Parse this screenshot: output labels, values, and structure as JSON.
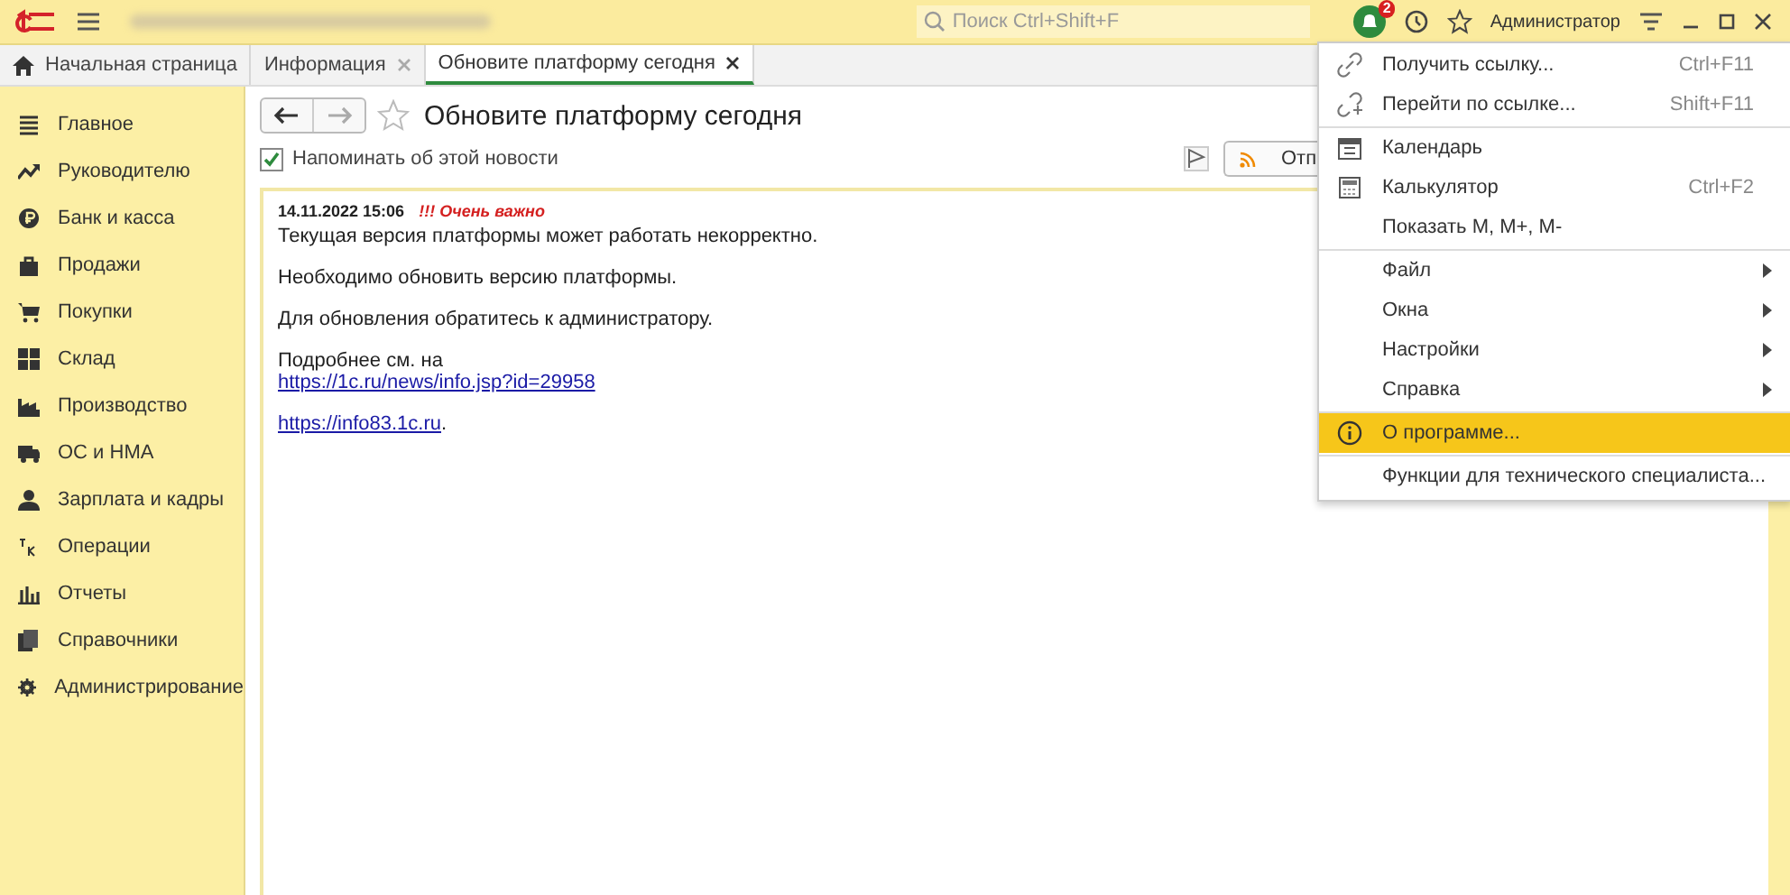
{
  "app_bar": {
    "search_placeholder": "Поиск Ctrl+Shift+F",
    "notifications": "2",
    "user": "Администратор"
  },
  "tabs": [
    {
      "label": "Начальная страница",
      "kind": "home",
      "selected": false
    },
    {
      "label": "Информация",
      "kind": "closable",
      "selected": false
    },
    {
      "label": "Обновите платформу сегодня",
      "kind": "closable",
      "selected": true
    }
  ],
  "sidebar": {
    "items": [
      {
        "label": "Главное",
        "kind": "list"
      },
      {
        "label": "Руководителю",
        "kind": "trend"
      },
      {
        "label": "Банк и касса",
        "kind": "coin"
      },
      {
        "label": "Продажи",
        "kind": "bag"
      },
      {
        "label": "Покупки",
        "kind": "cart"
      },
      {
        "label": "Склад",
        "kind": "grid"
      },
      {
        "label": "Производство",
        "kind": "factory"
      },
      {
        "label": "ОС и НМА",
        "kind": "truck"
      },
      {
        "label": "Зарплата и кадры",
        "kind": "person"
      },
      {
        "label": "Операции",
        "kind": "dtkt"
      },
      {
        "label": "Отчеты",
        "kind": "bars"
      },
      {
        "label": "Справочники",
        "kind": "books"
      },
      {
        "label": "Администрирование",
        "kind": "gear"
      }
    ]
  },
  "page": {
    "title": "Обновите платформу сегодня",
    "favorite": false,
    "remind": {
      "label": "Напоминать об этой новости",
      "checked": true
    },
    "button": "Отп",
    "news": {
      "date": "14.11.2022 15:06",
      "importance": "!!! Очень важно",
      "paragraphs": [
        {
          "lines": [
            {
              "kind": "text",
              "text": "Текущая версия платформы может работать некорректно."
            }
          ]
        },
        {
          "lines": [
            {
              "kind": "text",
              "text": "Необходимо обновить версию платформы."
            }
          ]
        },
        {
          "lines": [
            {
              "kind": "text",
              "text": "Для обновления обратитесь к администратору."
            }
          ]
        },
        {
          "lines": [
            {
              "kind": "text",
              "text": "Подробнее см. на"
            },
            {
              "kind": "link",
              "text": "https://1c.ru/news/info.jsp?id=29958"
            }
          ]
        },
        {
          "lines": [
            {
              "kind": "link",
              "text": "https://info83.1c.ru",
              "after": "."
            }
          ]
        }
      ]
    }
  },
  "menu": {
    "items": [
      {
        "label": "Получить ссылку...",
        "shortcut": "Ctrl+F11",
        "kind": "link",
        "separator_before": false,
        "submenu": false,
        "selected": false
      },
      {
        "label": "Перейти по ссылке...",
        "shortcut": "Shift+F11",
        "kind": "goto",
        "separator_before": false,
        "submenu": false,
        "selected": false
      },
      {
        "label": "Календарь",
        "kind": "calendar",
        "separator_before": true,
        "submenu": false,
        "selected": false
      },
      {
        "label": "Калькулятор",
        "shortcut": "Ctrl+F2",
        "kind": "calculator",
        "separator_before": false,
        "submenu": false,
        "selected": false
      },
      {
        "label": "Показать M, M+, M-",
        "kind": "none",
        "separator_before": false,
        "submenu": false,
        "selected": false
      },
      {
        "label": "Файл",
        "kind": "none",
        "separator_before": true,
        "submenu": true,
        "selected": false
      },
      {
        "label": "Окна",
        "kind": "none",
        "separator_before": false,
        "submenu": true,
        "selected": false
      },
      {
        "label": "Настройки",
        "kind": "none",
        "separator_before": false,
        "submenu": true,
        "selected": false
      },
      {
        "label": "Справка",
        "kind": "none",
        "separator_before": false,
        "submenu": true,
        "selected": false
      },
      {
        "label": "О программе...",
        "kind": "info",
        "separator_before": true,
        "submenu": false,
        "selected": true
      },
      {
        "label": "Функции для технического специалиста...",
        "kind": "none",
        "separator_before": true,
        "submenu": false,
        "selected": false
      }
    ]
  }
}
